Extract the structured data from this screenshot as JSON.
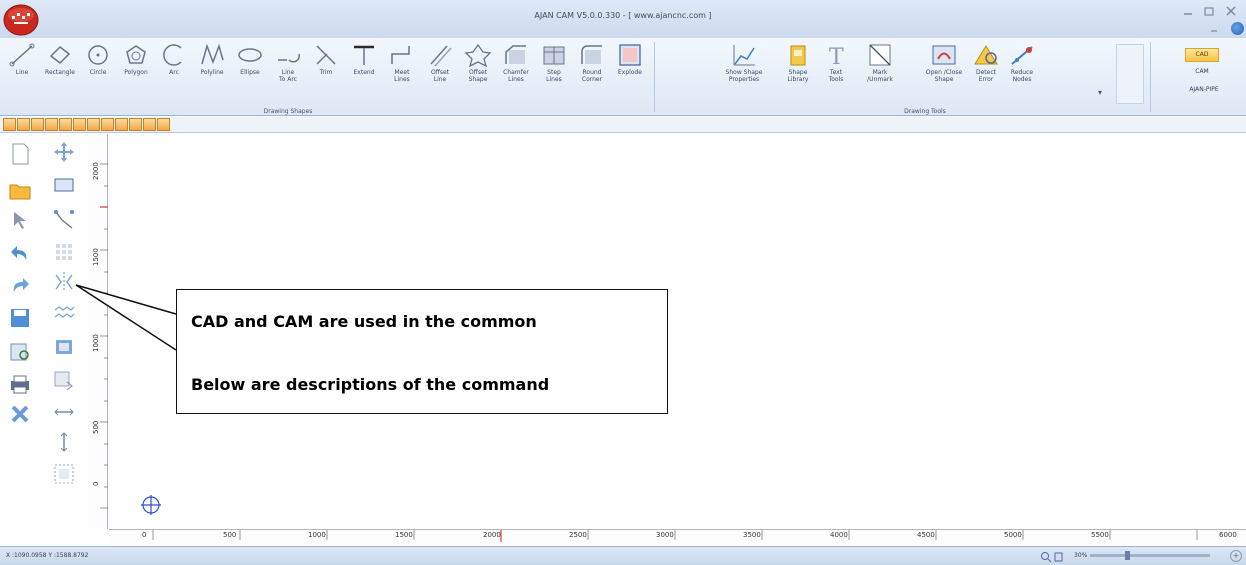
{
  "window": {
    "title": "AJAN CAM V5.0.0.330 - [ www.ajancnc.com ]",
    "accent_color": "#cbdaee"
  },
  "ribbon": {
    "drawing_shapes": {
      "group_label": "Drawing Shapes",
      "tools": [
        {
          "label": "Line",
          "icon": "line-icon"
        },
        {
          "label": "Rectangle",
          "icon": "rectangle-icon"
        },
        {
          "label": "Circle",
          "icon": "circle-icon"
        },
        {
          "label": "Polygon",
          "icon": "polygon-icon"
        },
        {
          "label": "Arc",
          "icon": "arc-icon"
        },
        {
          "label": "Polyline",
          "icon": "polyline-icon"
        },
        {
          "label": "Ellipse",
          "icon": "ellipse-icon"
        },
        {
          "label": "Line\nTo Arc",
          "icon": "line-to-arc-icon"
        },
        {
          "label": "Trim",
          "icon": "trim-icon"
        },
        {
          "label": "Extend",
          "icon": "extend-icon"
        },
        {
          "label": "Meet\nLines",
          "icon": "meet-lines-icon"
        },
        {
          "label": "Offset\nLine",
          "icon": "offset-line-icon"
        },
        {
          "label": "Offset\nShape",
          "icon": "offset-shape-icon"
        },
        {
          "label": "Chamfer\nLines",
          "icon": "chamfer-lines-icon"
        },
        {
          "label": "Step\nLines",
          "icon": "step-lines-icon"
        },
        {
          "label": "Round\nCorner",
          "icon": "round-corner-icon"
        },
        {
          "label": "Explode",
          "icon": "explode-icon"
        }
      ]
    },
    "drawing_tools": {
      "group_label": "Drawing Tools",
      "tools": [
        {
          "label": "Show Shape\nProperties",
          "icon": "shape-properties-icon"
        },
        {
          "label": "Shape\nLibrary",
          "icon": "shape-library-icon"
        },
        {
          "label": "Text\nTools",
          "icon": "text-tools-icon"
        },
        {
          "label": "Mark\n/Unmark",
          "icon": "mark-unmark-icon"
        },
        {
          "label": "Open /Close\nShape",
          "icon": "open-close-shape-icon"
        },
        {
          "label": "Detect\nError",
          "icon": "detect-error-icon"
        },
        {
          "label": "Reduce\nNodes",
          "icon": "reduce-nodes-icon"
        }
      ]
    },
    "modes": {
      "cad": "CAD",
      "cam": "CAM",
      "pipe": "AJAN-PIPE"
    }
  },
  "rulers": {
    "vertical_labels": [
      "2000",
      "1500",
      "1000",
      "500",
      "0"
    ],
    "horizontal_labels": [
      "0",
      "500",
      "1000",
      "1500",
      "2000",
      "2500",
      "3000",
      "3500",
      "4000",
      "4500",
      "5000",
      "5500",
      "6000"
    ]
  },
  "status": {
    "coordinates": "X :1090.0958 Y :1588.8792",
    "zoom": "30%",
    "zoom_fraction": 0.3
  },
  "callout": {
    "line1": "CAD and CAM are used in the common",
    "line2": "Below are descriptions of the command"
  }
}
